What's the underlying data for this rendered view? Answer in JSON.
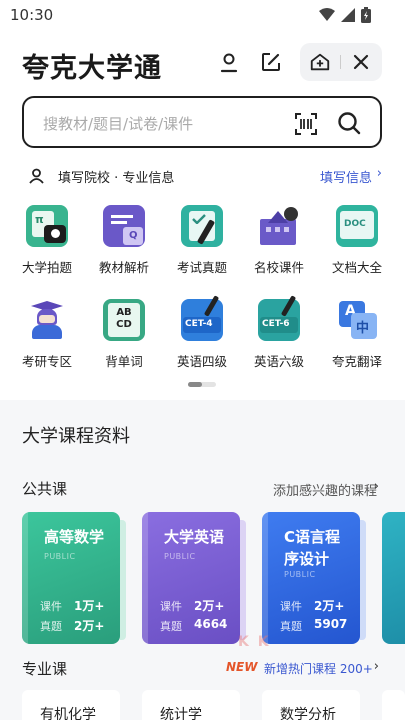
{
  "status": {
    "time": "10:30"
  },
  "header": {
    "title": "夸克大学通"
  },
  "search": {
    "placeholder": "搜教材/题目/试卷/课件"
  },
  "info": {
    "label": "填写院校 · 专业信息",
    "link": "填写信息",
    "arrow": "›"
  },
  "grid": [
    {
      "label": "大学拍题",
      "icon": "photo-question-icon"
    },
    {
      "label": "教材解析",
      "icon": "textbook-icon"
    },
    {
      "label": "考试真题",
      "icon": "exam-paper-icon"
    },
    {
      "label": "名校课件",
      "icon": "university-icon"
    },
    {
      "label": "文档大全",
      "icon": "doc-icon"
    },
    {
      "label": "考研专区",
      "icon": "graduate-icon"
    },
    {
      "label": "背单词",
      "icon": "vocabulary-icon"
    },
    {
      "label": "英语四级",
      "icon": "cet4-icon"
    },
    {
      "label": "英语六级",
      "icon": "cet6-icon"
    },
    {
      "label": "夸克翻译",
      "icon": "translate-icon"
    }
  ],
  "grid_badges": {
    "doc": "DOC",
    "abcd": "AB CD",
    "cet4": "CET-4",
    "cet6": "CET-6",
    "a": "A",
    "zh": "中"
  },
  "section": {
    "title": "大学课程资料",
    "public": "公共课",
    "public_link": "添加感兴趣的课程",
    "major": "专业课",
    "new_badge": "NEW",
    "new_text": "新增热门课程 200+",
    "arrow": "›",
    "watermark": "K K"
  },
  "cards": [
    {
      "title": "高等数学",
      "sub": "PUBLIC",
      "r1": "课件",
      "v1": "1万+",
      "r2": "真题",
      "v2": "2万+"
    },
    {
      "title": "大学英语",
      "sub": "PUBLIC",
      "r1": "课件",
      "v1": "2万+",
      "r2": "真题",
      "v2": "4664"
    },
    {
      "title": "C语言程序设计",
      "sub": "PUBLIC",
      "r1": "课件",
      "v1": "2万+",
      "r2": "真题",
      "v2": "5907"
    }
  ],
  "major_cards": [
    {
      "label": "有机化学"
    },
    {
      "label": "统计学"
    },
    {
      "label": "数学分析"
    }
  ],
  "colors": {
    "accent": "#3a58d0",
    "card1": "#2fb48c",
    "card2": "#7a5dd6",
    "card3": "#3169e8"
  }
}
